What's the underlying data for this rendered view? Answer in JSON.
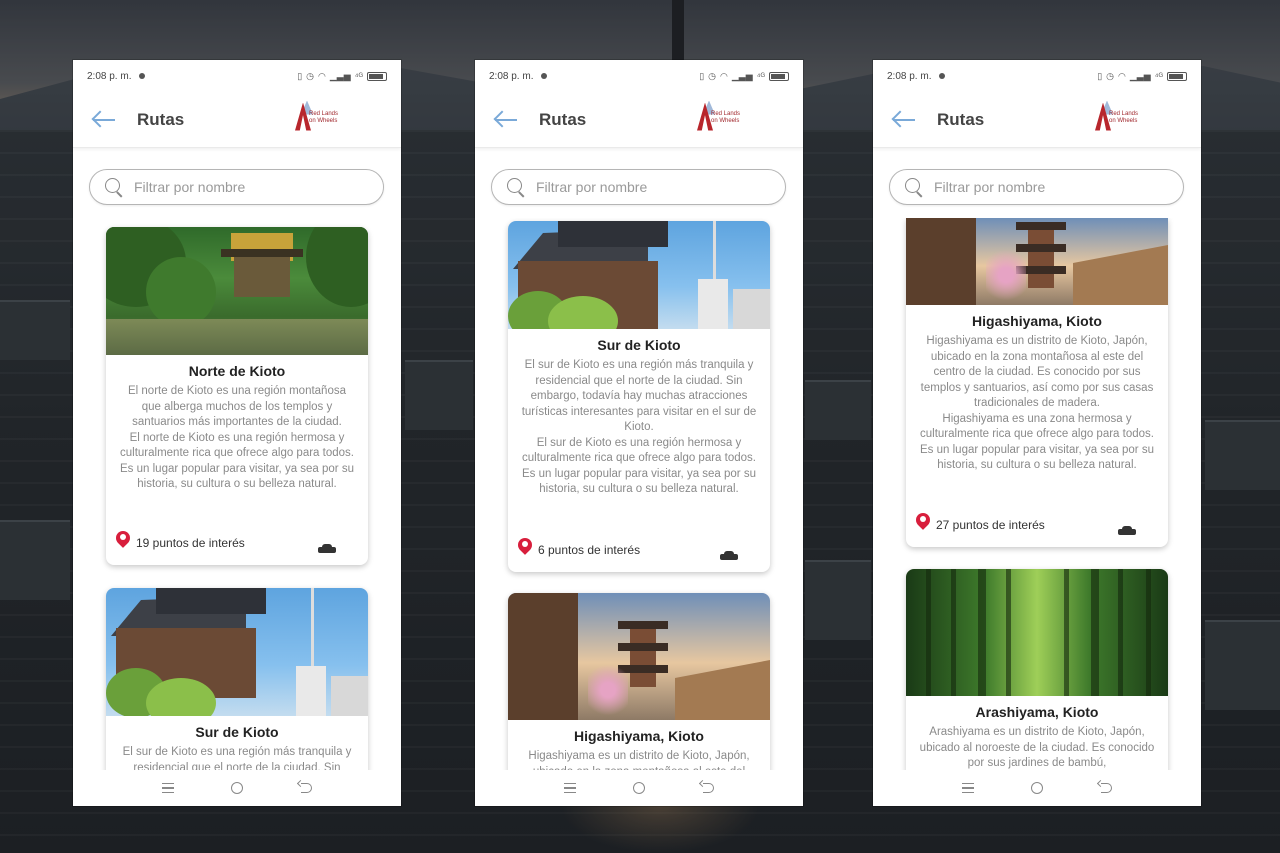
{
  "phones": [
    {
      "status_time": "2:08 p. m.",
      "status_icons": [
        "vibrate-icon",
        "alarm-icon",
        "wifi-icon",
        "signal-icon",
        "4g-icon",
        "battery-icon"
      ],
      "title": "Rutas",
      "logo_text": "Red Lands on Wheels",
      "search_placeholder": "Filtrar por nombre",
      "cards": [
        {
          "image": "golden-pavilion-garden",
          "title": "Norte de Kioto",
          "description": "El norte de Kioto es una región montañosa que alberga muchos de los templos y santuarios más importantes de la ciudad.\nEl norte de Kioto es una región hermosa y culturalmente rica que ofrece algo para todos. Es un lugar popular para visitar, ya sea por su historia, su cultura o su belleza natural.",
          "poi": "19 puntos de interés"
        },
        {
          "image": "temple-and-city-tower",
          "title": "Sur de Kioto",
          "description": "El sur de Kioto es una región más tranquila y residencial que el norte de la ciudad. Sin",
          "poi": ""
        }
      ]
    },
    {
      "status_time": "2:08 p. m.",
      "status_icons": [
        "vibrate-icon",
        "alarm-icon",
        "wifi-icon",
        "signal-icon",
        "4g-icon",
        "battery-icon"
      ],
      "title": "Rutas",
      "logo_text": "Red Lands on Wheels",
      "search_placeholder": "Filtrar por nombre",
      "cards": [
        {
          "image": "temple-and-city-tower",
          "title": "Sur de Kioto",
          "description": "El sur de Kioto es una región más tranquila y residencial que el norte de la ciudad. Sin embargo, todavía hay muchas atracciones turísticas interesantes para visitar en el sur de Kioto.\nEl sur de Kioto es una región hermosa y culturalmente rica que ofrece algo para todos. Es un lugar popular para visitar, ya sea por su historia, su cultura o su belleza natural.",
          "poi": "6 puntos de interés"
        },
        {
          "image": "pagoda-street",
          "title": "Higashiyama, Kioto",
          "description": "Higashiyama es un distrito de Kioto, Japón, ubicado en la zona montañosa al este del",
          "poi": ""
        }
      ]
    },
    {
      "status_time": "2:08 p. m.",
      "status_icons": [
        "vibrate-icon",
        "alarm-icon",
        "wifi-icon",
        "signal-icon",
        "4g-icon",
        "battery-icon"
      ],
      "title": "Rutas",
      "logo_text": "Red Lands on Wheels",
      "search_placeholder": "Filtrar por nombre",
      "cards": [
        {
          "image": "pagoda-street",
          "title": "Higashiyama, Kioto",
          "description": "Higashiyama es un distrito de Kioto, Japón, ubicado en la zona montañosa al este del centro de la ciudad. Es conocido por sus templos y santuarios, así como por sus casas tradicionales de madera.\nHigashiyama es una zona hermosa y culturalmente rica que ofrece algo para todos. Es un lugar popular para visitar, ya sea por su historia, su cultura o su belleza natural.",
          "poi": "27 puntos de interés"
        },
        {
          "image": "bamboo-forest",
          "title": "Arashiyama, Kioto",
          "description": "Arashiyama es un distrito de Kioto, Japón, ubicado al noroeste de la ciudad. Es conocido por sus jardines de bambú,",
          "poi": ""
        }
      ]
    }
  ]
}
